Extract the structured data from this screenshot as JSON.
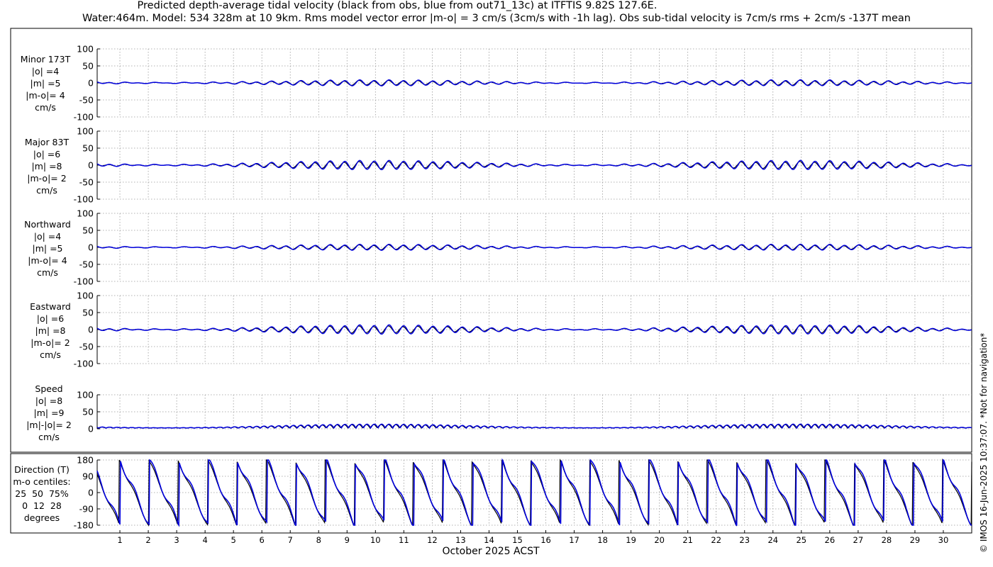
{
  "header": {
    "title_line1": "Predicted depth-average tidal velocity (black from obs, blue from out71_13c) at ITFTIS 9.82S 127.6E.",
    "title_line2": "Water:464m. Model: 534 328m at 10 9km. Rms model vector error |m-o| = 3 cm/s (3cm/s with -1h lag). Obs sub-tidal velocity is 7cm/s rms + 2cm/s -137T mean"
  },
  "credit": "© IMOS 16-Jun-2025 10:37:07. *Not for navigation*",
  "colors": {
    "obs": "#000000",
    "model": "#0000dd",
    "grid": "#999999"
  },
  "chart_data": {
    "type": "line",
    "xlabel": "October 2025 ACST",
    "x_ticks": [
      "1",
      "2",
      "3",
      "4",
      "5",
      "6",
      "7",
      "8",
      "9",
      "10",
      "11",
      "12",
      "13",
      "14",
      "15",
      "16",
      "17",
      "18",
      "19",
      "20",
      "21",
      "22",
      "23",
      "24",
      "25",
      "26",
      "27",
      "28",
      "29",
      "30"
    ],
    "xlim_days": [
      0.2,
      31.0
    ],
    "series_names": [
      "obs",
      "out71_13c"
    ],
    "panels": [
      {
        "id": "minor",
        "labels": [
          "Minor 173T",
          "|o| =4",
          "|m| =5",
          "|m-o|= 4",
          "cm/s"
        ],
        "ylim": [
          -100,
          100
        ],
        "yticks": [
          "100",
          "50",
          "0",
          "-50",
          "-100"
        ],
        "amplitude_obs_cm_s": 4,
        "amplitude_model_cm_s": 5
      },
      {
        "id": "major",
        "labels": [
          "Major 83T",
          "|o| =6",
          "|m| =8",
          "|m-o|= 2",
          "cm/s"
        ],
        "ylim": [
          -100,
          100
        ],
        "yticks": [
          "100",
          "50",
          "0",
          "-50",
          "-100"
        ],
        "amplitude_obs_cm_s": 6,
        "amplitude_model_cm_s": 8
      },
      {
        "id": "north",
        "labels": [
          "Northward",
          "|o| =4",
          "|m| =5",
          "|m-o|= 4",
          "cm/s"
        ],
        "ylim": [
          -100,
          100
        ],
        "yticks": [
          "100",
          "50",
          "0",
          "-50",
          "-100"
        ],
        "amplitude_obs_cm_s": 4,
        "amplitude_model_cm_s": 5
      },
      {
        "id": "east",
        "labels": [
          "Eastward",
          "|o| =6",
          "|m| =8",
          "|m-o|= 2",
          "cm/s"
        ],
        "ylim": [
          -100,
          100
        ],
        "yticks": [
          "100",
          "50",
          "0",
          "-50",
          "-100"
        ],
        "amplitude_obs_cm_s": 6,
        "amplitude_model_cm_s": 8
      },
      {
        "id": "speed",
        "labels": [
          "Speed",
          "|o| =8",
          "|m| =9",
          "|m|-|o|= 2",
          "cm/s"
        ],
        "ylim": [
          0,
          100
        ],
        "yticks": [
          "100",
          "50",
          "0"
        ],
        "amplitude_obs_cm_s": 8,
        "amplitude_model_cm_s": 9
      },
      {
        "id": "direction",
        "labels": [
          "Direction (T)",
          "m-o centiles:",
          "25  50  75%",
          "0  12  28",
          "degrees"
        ],
        "ylim": [
          -180,
          180
        ],
        "yticks": [
          "180",
          "90",
          "0",
          "-90",
          "-180"
        ]
      }
    ]
  }
}
